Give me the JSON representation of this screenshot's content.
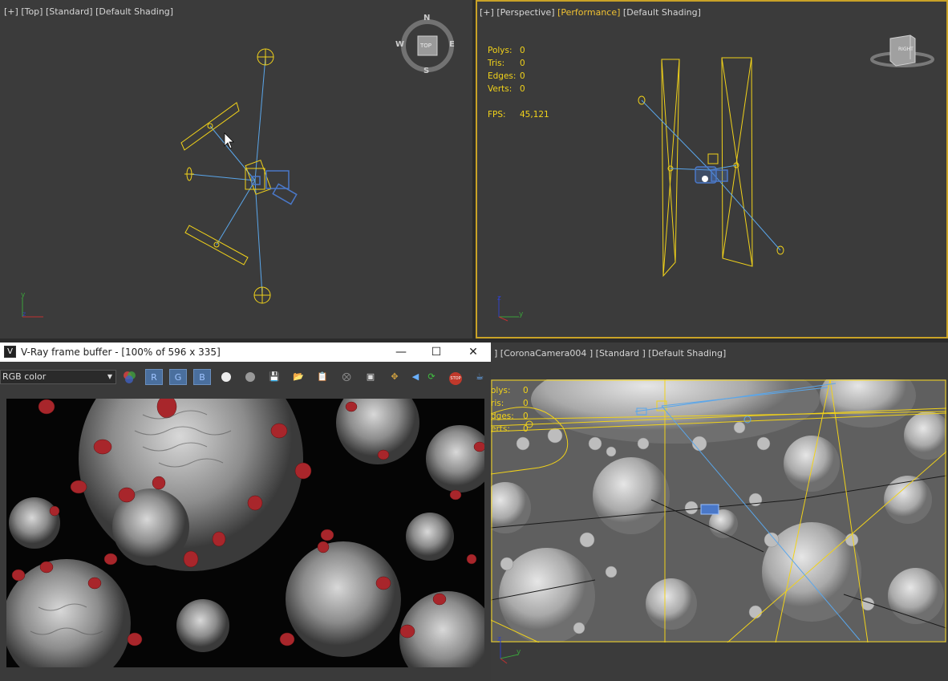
{
  "viewport_top": {
    "label_plus": "[+]",
    "label_view": "[Top]",
    "label_mode": "[Standard]",
    "label_shading": "[Default Shading]",
    "compass": {
      "n": "N",
      "s": "S",
      "e": "E",
      "w": "W",
      "cube": "TOP"
    }
  },
  "viewport_perspective": {
    "label_plus": "[+]",
    "label_view": "[Perspective]",
    "label_perf": "[Performance]",
    "label_shading": "[Default Shading]",
    "stats": {
      "polys_k": "Polys:",
      "polys_v": "0",
      "tris_k": "Tris:",
      "tris_v": "0",
      "edges_k": "Edges:",
      "edges_v": "0",
      "verts_k": "Verts:",
      "verts_v": "0",
      "fps_k": "FPS:",
      "fps_v": "45,121"
    },
    "cube": "RIGHT"
  },
  "viewport_camera": {
    "label": "] [CoronaCamera004 ] [Standard ] [Default Shading]",
    "stats": {
      "polys_k": "olys:",
      "polys_v": "0",
      "tris_k": "ris:",
      "tris_v": "0",
      "edges_k": "dges:",
      "edges_v": "0",
      "verts_k": "erts:",
      "verts_v": "0"
    }
  },
  "vfb": {
    "title": "V-Ray frame buffer - [100% of 596 x 335]",
    "channel": "RGB color",
    "r": "R",
    "g": "G",
    "b": "B",
    "stop": "STOP"
  },
  "colors": {
    "viewport_bg": "#3b3b3b",
    "wire_yellow": "#f1d21a",
    "wire_blue": "#4a90d9",
    "virus_red": "#a8262b"
  }
}
